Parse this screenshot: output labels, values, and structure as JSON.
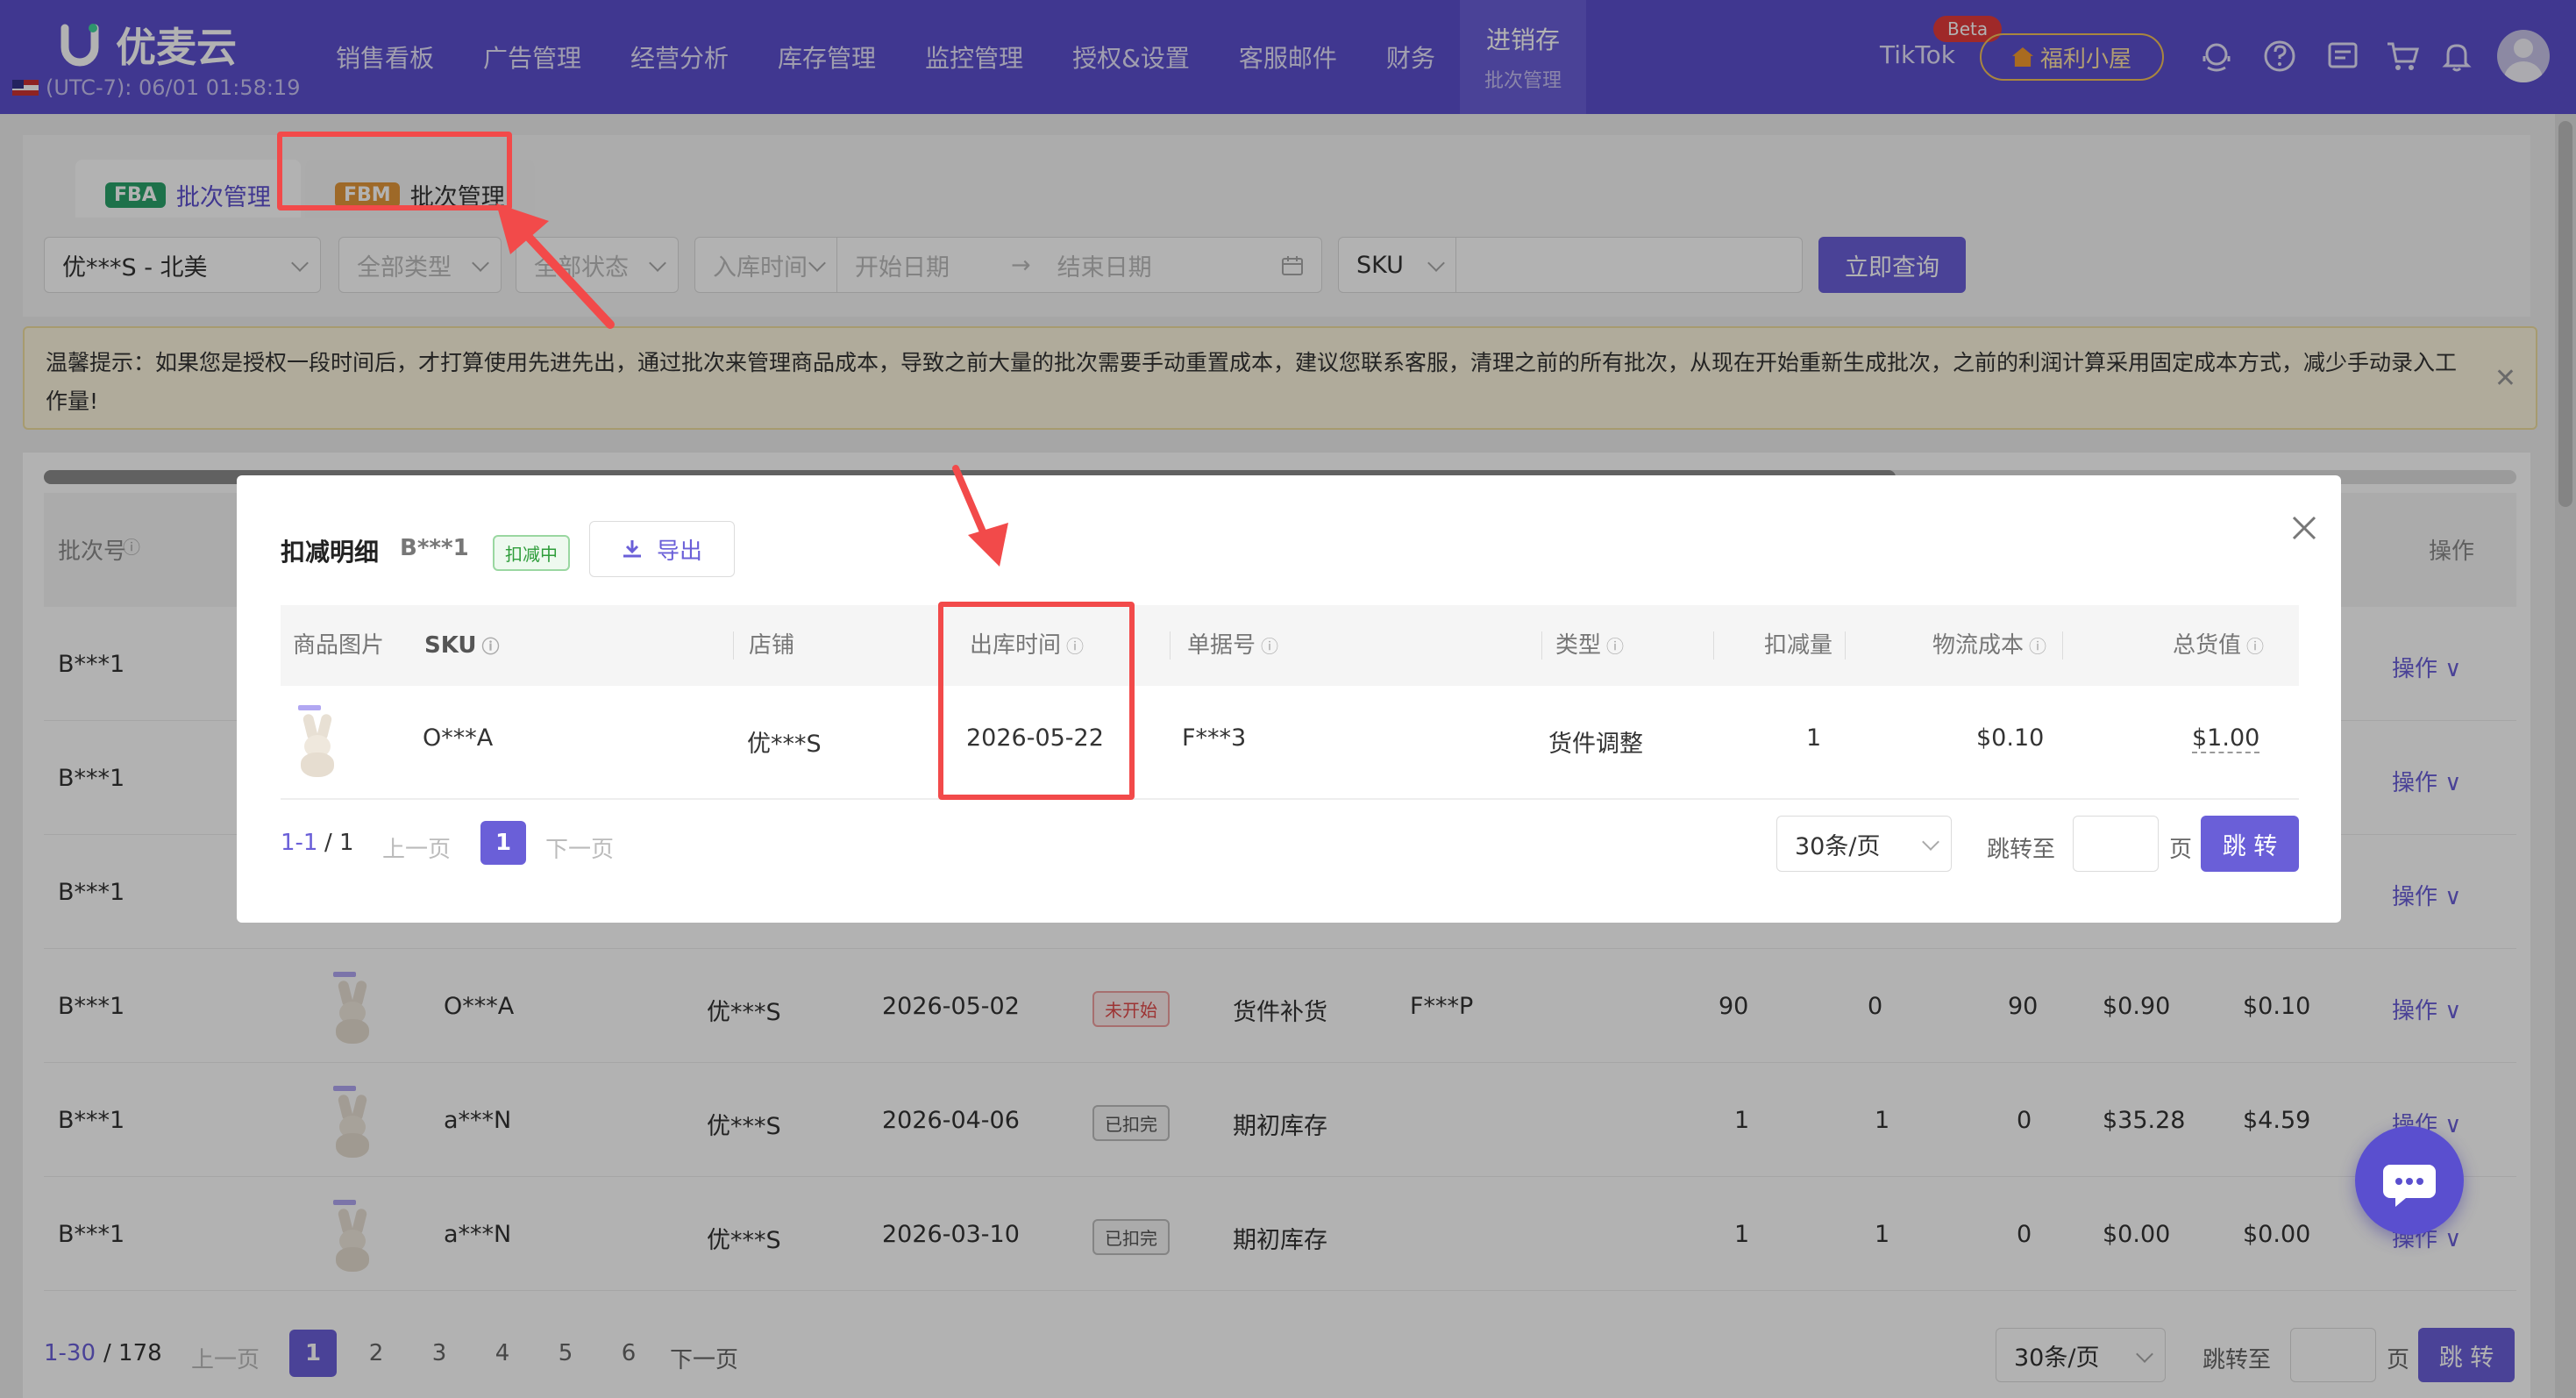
{
  "app": {
    "logo_text": "优麦云",
    "timezone": "(UTC-7): 06/01 01:58:19",
    "brand_color": "#5c4fcf"
  },
  "nav": {
    "items": [
      "销售看板",
      "广告管理",
      "经营分析",
      "库存管理",
      "监控管理",
      "授权&设置",
      "客服邮件",
      "财务"
    ],
    "active": {
      "label": "进销存",
      "sub": "批次管理"
    },
    "tiktok": "TikTok",
    "beta": "Beta",
    "welfare": "福利小屋",
    "icons": [
      "customer-service-icon",
      "help-icon",
      "message-icon",
      "cart-icon",
      "bell-icon",
      "avatar"
    ]
  },
  "tabs": [
    {
      "chip": "FBA",
      "label": "批次管理",
      "chip_color": "#2aa36a"
    },
    {
      "chip": "FBM",
      "label": "批次管理",
      "chip_color": "#e2973a"
    }
  ],
  "filters": {
    "shop": "优***S - 北美",
    "type": "全部类型",
    "status": "全部状态",
    "date_type": "入库时间",
    "start": "开始日期",
    "end": "结束日期",
    "search_field": "SKU",
    "query_button": "立即查询"
  },
  "notice": {
    "text": "温馨提示：如果您是授权一段时间后，才打算使用先进先出，通过批次来管理商品成本，导致之前大量的批次需要手动重置成本，建议您联系客服，清理之前的所有批次，从现在开始重新生成批次，之前的利润计算采用固定成本方式，减少手动录入工作量!"
  },
  "table": {
    "headers": {
      "batch": "批次号",
      "ops": "操作"
    },
    "rows": [
      {
        "batch": "B***1",
        "ops": "操作"
      },
      {
        "batch": "B***1",
        "ops": "操作"
      },
      {
        "batch": "B***1",
        "ops": "操作"
      },
      {
        "batch": "B***1",
        "sku": "O***A",
        "shop": "优***S",
        "date": "2026-05-02",
        "status": "未开始",
        "type": "货件补货",
        "doc": "F***P",
        "c1": "90",
        "c2": "0",
        "c3": "90",
        "c4": "$0.90",
        "c5": "$0.10",
        "ops": "操作"
      },
      {
        "batch": "B***1",
        "sku": "a***N",
        "shop": "优***S",
        "date": "2026-04-06",
        "status": "已扣完",
        "type": "期初库存",
        "doc": "",
        "c1": "1",
        "c2": "1",
        "c3": "0",
        "c4": "$35.28",
        "c5": "$4.59",
        "ops": "操作"
      },
      {
        "batch": "B***1",
        "sku": "a***N",
        "shop": "优***S",
        "date": "2026-03-10",
        "status": "已扣完",
        "type": "期初库存",
        "doc": "",
        "c1": "1",
        "c2": "1",
        "c3": "0",
        "c4": "$0.00",
        "c5": "$0.00",
        "ops": "操作"
      }
    ]
  },
  "pagination": {
    "range": "1-30",
    "total": "/ 178",
    "prev": "上一页",
    "next": "下一页",
    "pages": [
      "1",
      "2",
      "3",
      "4",
      "5",
      "6"
    ],
    "page_size": "30条/页",
    "jump_label": "跳转至",
    "page_unit": "页",
    "jump_button": "跳 转"
  },
  "modal": {
    "title": "扣减明细",
    "batch": "B***1",
    "status": "扣减中",
    "export": "导出",
    "headers": [
      "商品图片",
      "SKU",
      "店铺",
      "出库时间",
      "单据号",
      "类型",
      "扣减量",
      "物流成本",
      "总货值"
    ],
    "row": {
      "sku": "O***A",
      "shop": "优***S",
      "date": "2026-05-22",
      "doc": "F***3",
      "type": "货件调整",
      "qty": "1",
      "logistics": "$0.10",
      "total": "$1.00"
    },
    "pagination": {
      "range": "1-1",
      "total": "/ 1",
      "prev": "上一页",
      "page": "1",
      "next": "下一页",
      "page_size": "30条/页",
      "jump_label": "跳转至",
      "page_unit": "页",
      "jump_button": "跳 转"
    }
  }
}
